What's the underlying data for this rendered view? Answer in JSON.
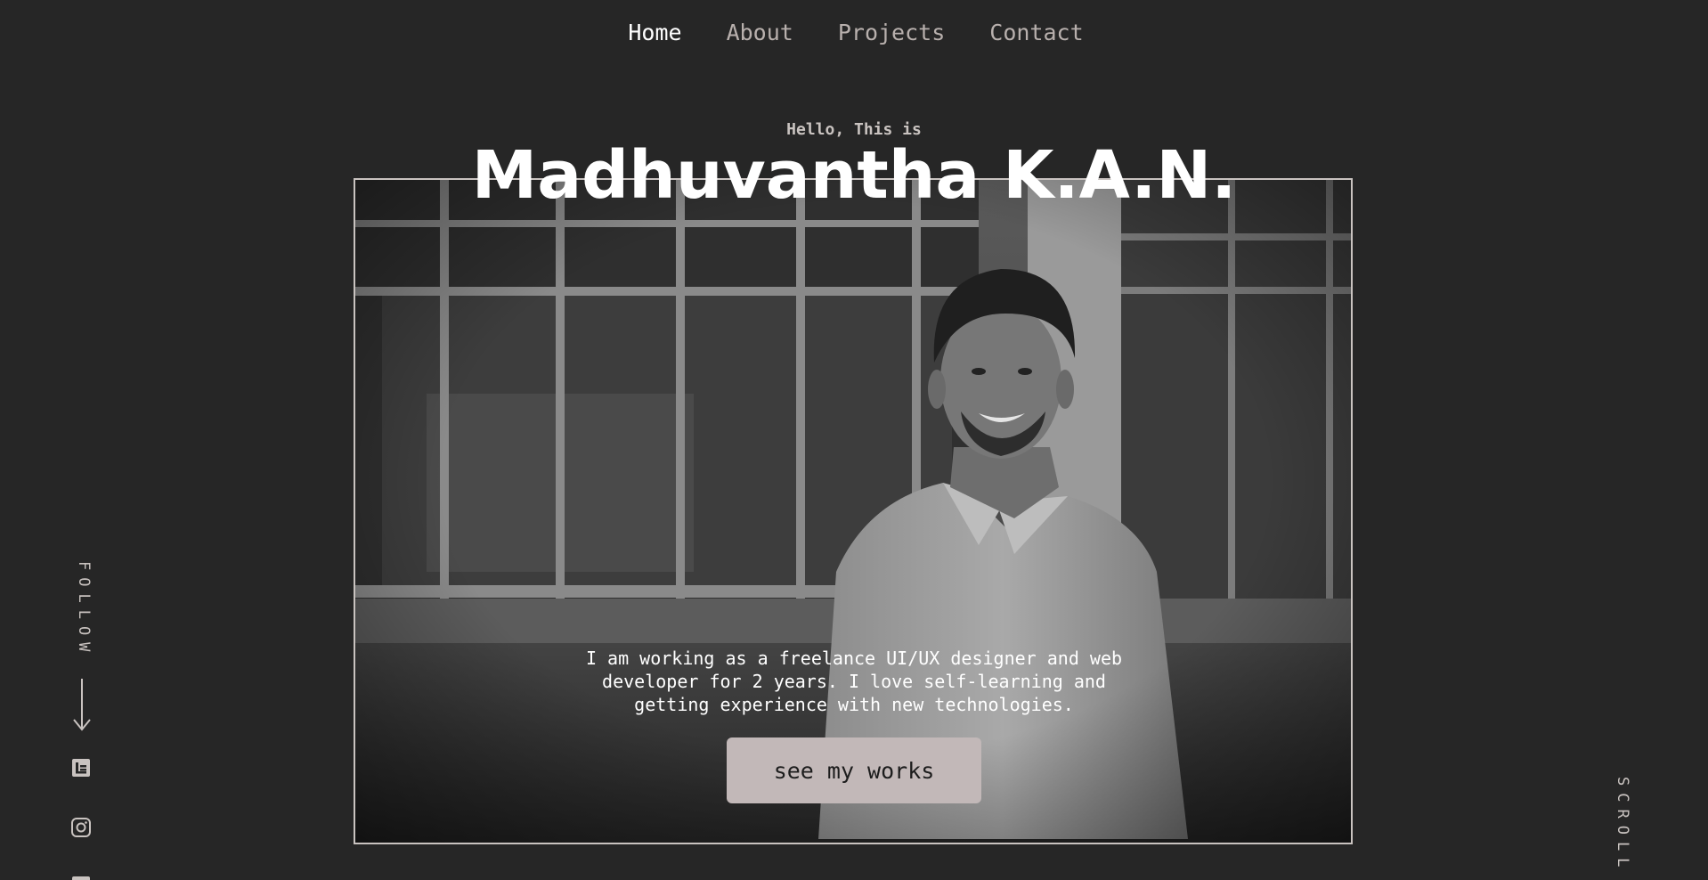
{
  "nav": {
    "items": [
      {
        "label": "Home",
        "active": true
      },
      {
        "label": "About",
        "active": false
      },
      {
        "label": "Projects",
        "active": false
      },
      {
        "label": "Contact",
        "active": false
      }
    ]
  },
  "hero": {
    "intro": "Hello, This is",
    "name": "Madhuvantha K.A.N.",
    "bio": "I am working as a freelance UI/UX designer and web developer for 2 years. I love self-learning and getting experience with new technologies.",
    "cta_label": "see my works"
  },
  "sidebar": {
    "follow_label": "FOLLOW",
    "social_icons": [
      "medium-icon",
      "instagram-icon",
      "social-icon"
    ]
  },
  "scroll_label": "SCROLL",
  "colors": {
    "background": "#262626",
    "text": "#ffffff",
    "muted": "#b8b0ad",
    "button": "#c2b8b8"
  }
}
